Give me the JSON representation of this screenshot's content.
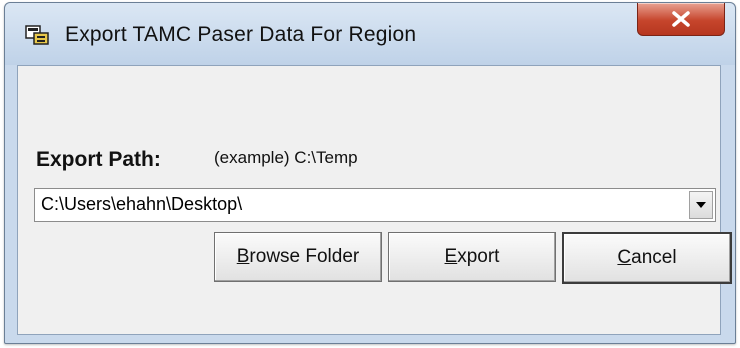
{
  "window": {
    "title": "Export TAMC Paser Data For Region",
    "icon": "export-app-icon",
    "close_icon": "close-icon"
  },
  "form": {
    "path_label": "Export Path:",
    "path_example": "(example) C:\\Temp",
    "path_value": "C:\\Users\\ehahn\\Desktop\\",
    "dropdown_icon": "chevron-down-icon"
  },
  "buttons": {
    "browse": {
      "mnemonic": "B",
      "rest": "rowse Folder"
    },
    "export": {
      "mnemonic": "E",
      "rest": "xport"
    },
    "cancel": {
      "mnemonic": "C",
      "rest": "ancel"
    }
  },
  "colors": {
    "close_button": "#c6452c",
    "titlebar": "#bfd2e8",
    "client_bg": "#f0f0f0"
  }
}
